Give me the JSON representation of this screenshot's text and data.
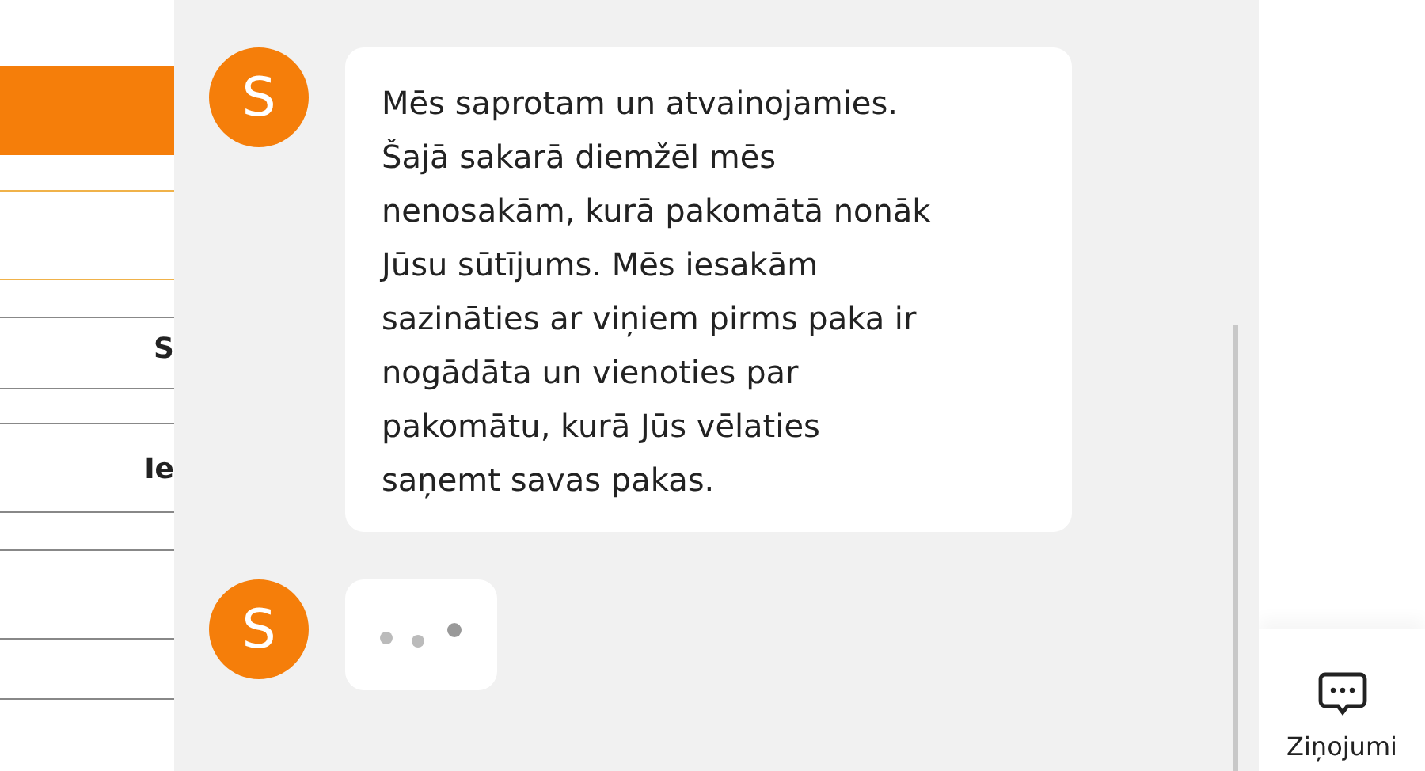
{
  "page_behind": {
    "labels": [
      "S",
      "Ie"
    ]
  },
  "chat": {
    "messages": [
      {
        "kind": "text",
        "avatar": "S",
        "lines": [
          "Mēs saprotam un atvainojamies.",
          "Šajā sakarā diemžēl mēs",
          "nenosakām, kurā pakomātā nonāk",
          "Jūsu sūtījums. Mēs iesakām",
          "sazināties ar viņiem pirms paka ir",
          "nogādāta un vienoties par",
          "pakomātu, kurā Jūs vēlaties",
          "saņemt savas pakas."
        ]
      },
      {
        "kind": "typing",
        "avatar": "S"
      }
    ]
  },
  "messages_button": {
    "label": "Ziņojumi"
  }
}
